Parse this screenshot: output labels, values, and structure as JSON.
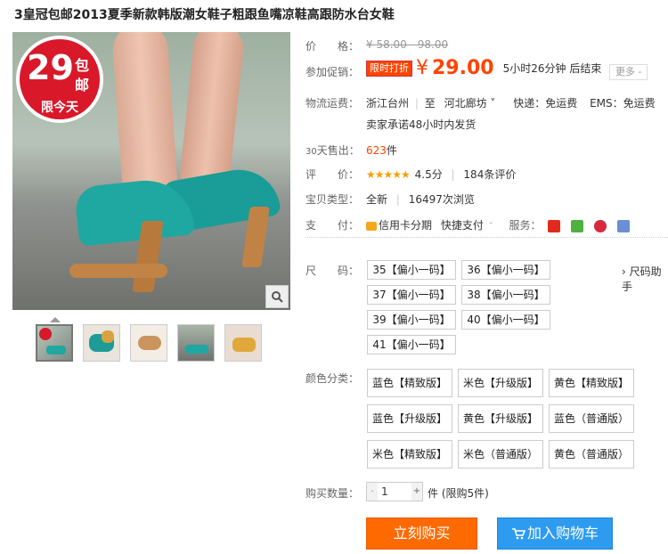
{
  "title": "3皇冠包邮2013夏季新款韩版潮女鞋子粗跟鱼嘴凉鞋高跟防水台女鞋",
  "badge": {
    "number": "29",
    "top1": "包",
    "top2": "邮",
    "bottom": "限今天"
  },
  "price": {
    "label": "价　　格：",
    "original": "¥ 58.00 - 98.00"
  },
  "promo": {
    "label": "参加促销：",
    "tag": "限时打折",
    "currency": "¥",
    "price": "29.00",
    "countdown": "5小时26分钟 后结束",
    "more": "更多 -"
  },
  "shipping": {
    "label": "物流运费：",
    "from": "浙江台州",
    "to_prefix": "至",
    "to": "河北廊坊 ˅",
    "express": "快递：免运费",
    "ems": "EMS：免运费",
    "promise": "卖家承诺48小时内发货"
  },
  "sales": {
    "label_prefix": "30",
    "label": "天售出：",
    "count": "623",
    "unit": "件"
  },
  "rating": {
    "label": "评　　价：",
    "stars": "★★★★★",
    "score": "4.5分",
    "sep": "|",
    "reviews": "184条评价"
  },
  "type": {
    "label": "宝贝类型：",
    "value": "全新",
    "sep": "|",
    "views": "16497次浏览"
  },
  "payment": {
    "label": "支　　付：",
    "credit": "信用卡分期",
    "quick": "快捷支付",
    "service_label": "服务："
  },
  "size": {
    "label": "尺　　码：",
    "guide": "› 尺码助手",
    "options": [
      "35【偏小一码】",
      "36【偏小一码】",
      "37【偏小一码】",
      "38【偏小一码】",
      "39【偏小一码】",
      "40【偏小一码】",
      "41【偏小一码】"
    ]
  },
  "color": {
    "label": "颜色分类：",
    "options": [
      "蓝色【精致版】",
      "米色【升级版】",
      "黄色【精致版】",
      "蓝色【升级版】",
      "黄色【升级版】",
      "蓝色（普通版）",
      "米色【精致版】",
      "米色（普通版）",
      "黄色（普通版）"
    ]
  },
  "quantity": {
    "label": "购买数量：",
    "value": "1",
    "minus": "-",
    "plus": "+",
    "limit": "件 (限购5件)"
  },
  "buttons": {
    "buy": "立刻购买",
    "cart": "加入购物车"
  },
  "colors": {
    "accent": "#ff4400",
    "buy": "#ff6a00",
    "cart": "#2d9bf0",
    "badge": "#d9182a"
  }
}
